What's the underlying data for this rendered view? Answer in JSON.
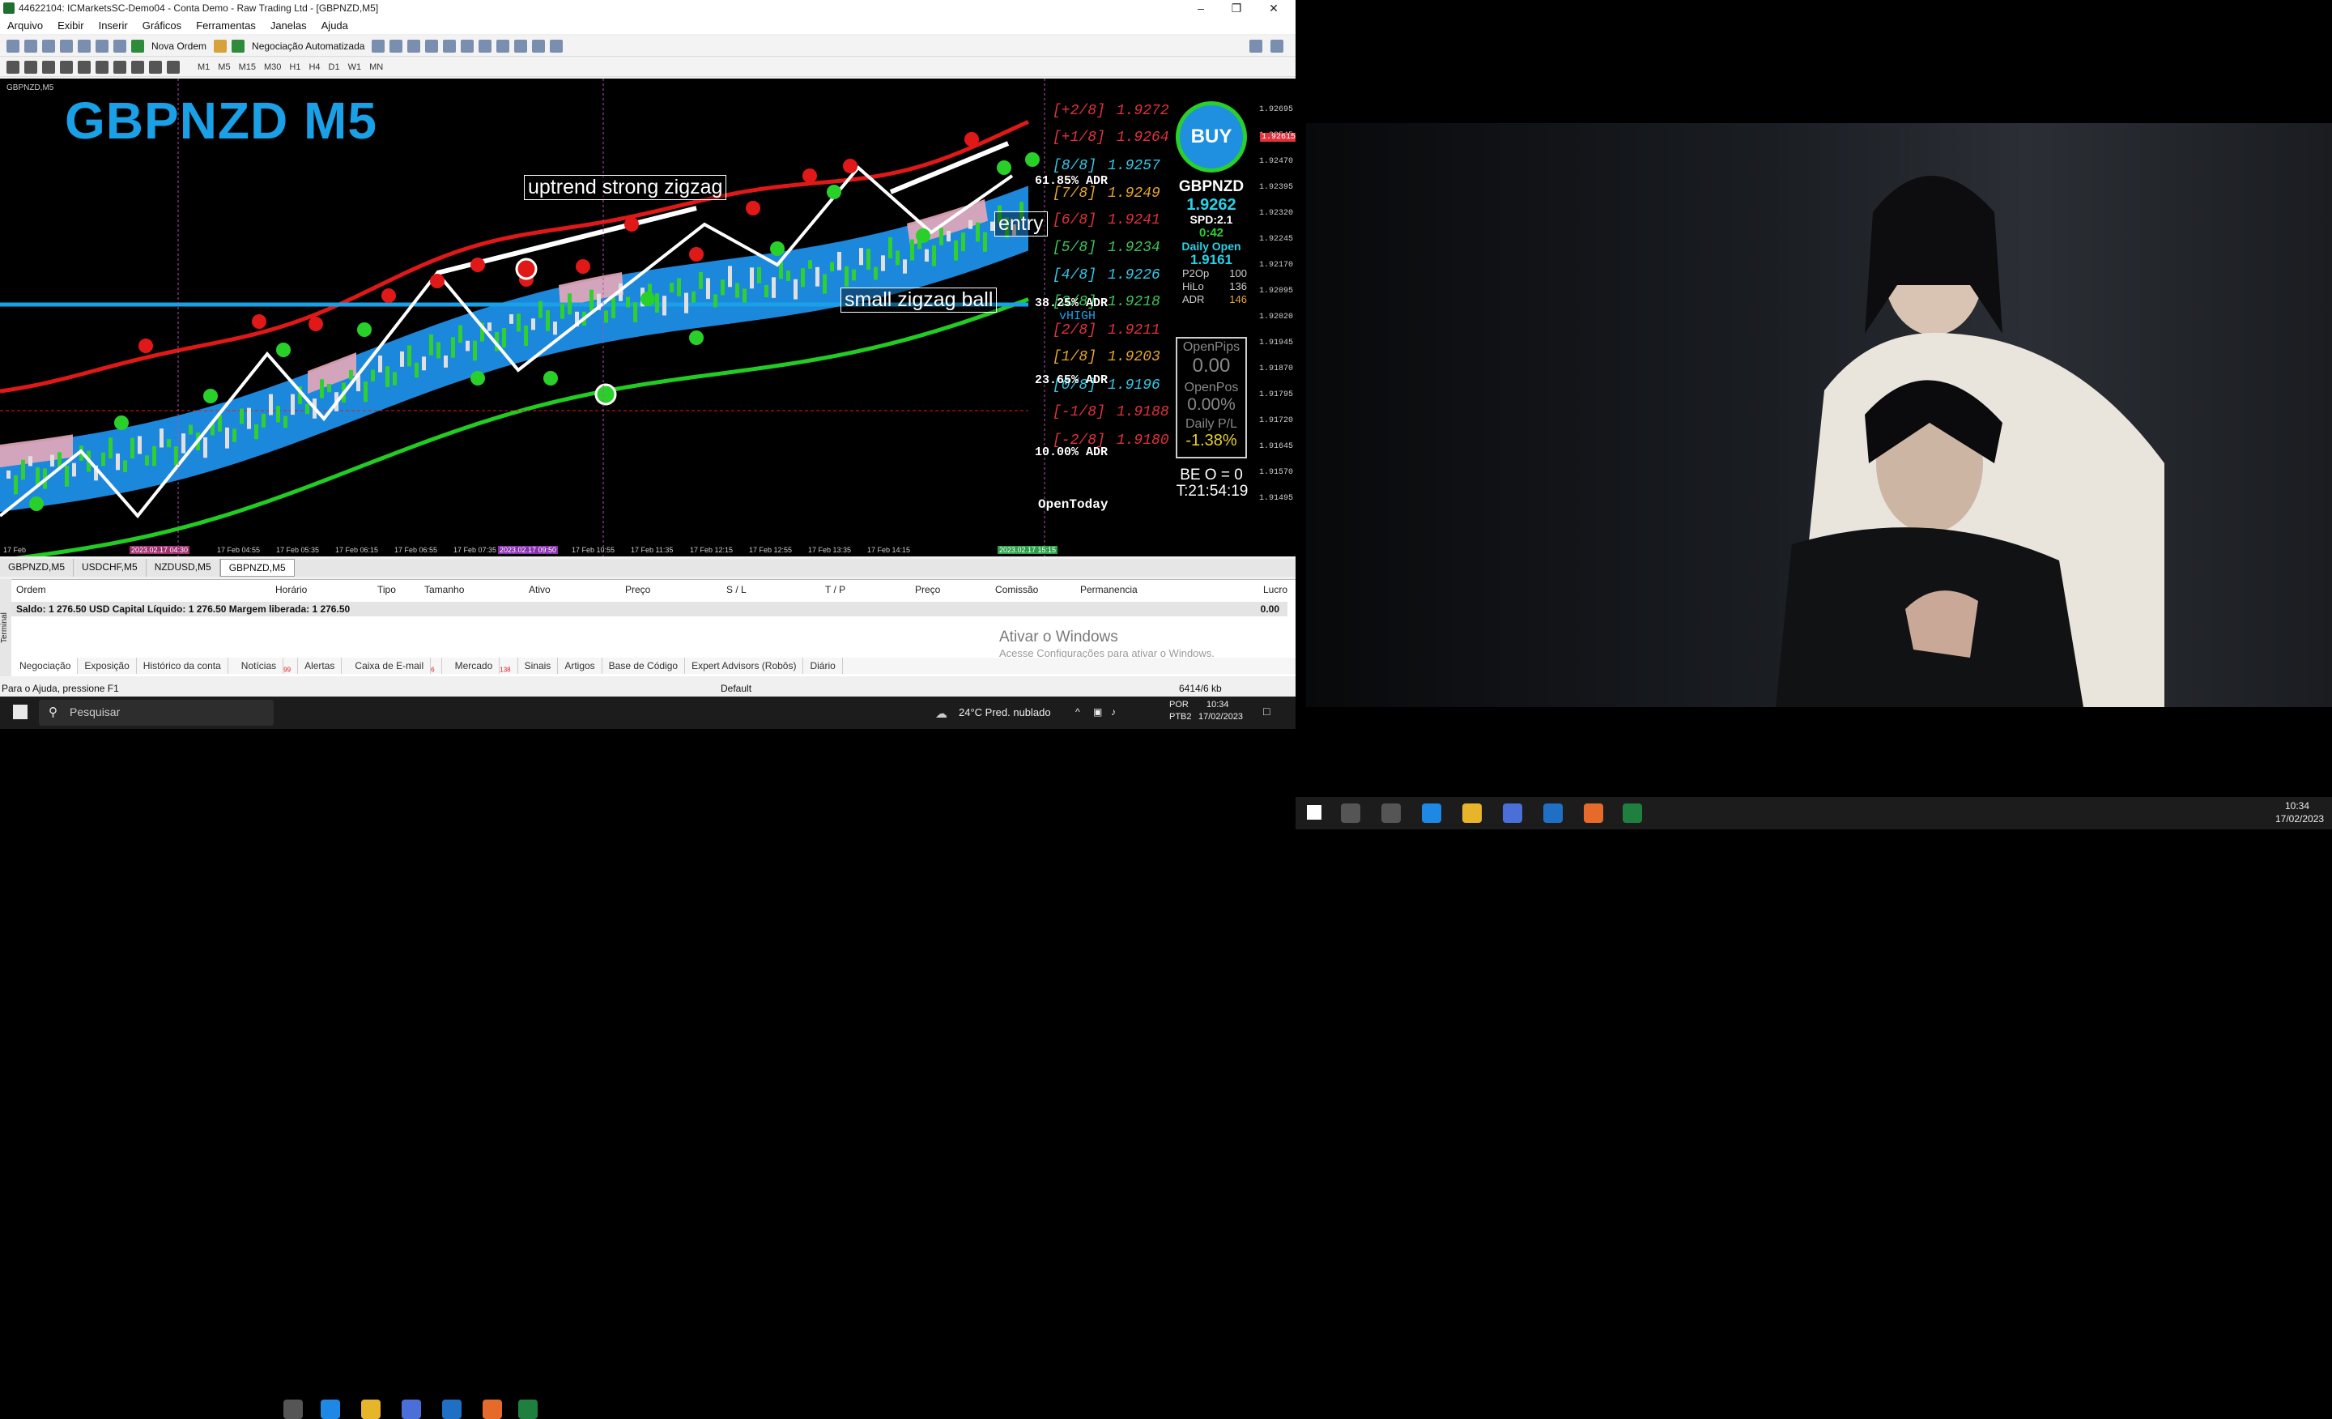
{
  "window": {
    "title": "44622104: ICMarketsSC-Demo04 - Conta Demo - Raw Trading Ltd - [GBPNZD,M5]"
  },
  "menu": [
    "Arquivo",
    "Exibir",
    "Inserir",
    "Gráficos",
    "Ferramentas",
    "Janelas",
    "Ajuda"
  ],
  "toolbar": {
    "new_order": "Nova Ordem",
    "auto_trading": "Negociação Automatizada"
  },
  "timeframes": [
    "M1",
    "M5",
    "M15",
    "M30",
    "H1",
    "H4",
    "D1",
    "W1",
    "MN"
  ],
  "chart": {
    "symbol_label": "GBPNZD M5",
    "chip_label": "GBPNZD,M5",
    "annotations": {
      "uptrend": "uptrend strong zigzag",
      "entry": "entry",
      "small": "small zigzag ball"
    },
    "levels": [
      {
        "label": "[+2/8]",
        "value": "1.9272",
        "color": "#e0323c"
      },
      {
        "label": "[+1/8]",
        "value": "1.9264",
        "color": "#e0323c"
      },
      {
        "label": "[8/8]",
        "value": "1.9257",
        "color": "#33c7e6"
      },
      {
        "label": "[7/8]",
        "value": "1.9249",
        "color": "#e6a62a"
      },
      {
        "label": "[6/8]",
        "value": "1.9241",
        "color": "#e0323c"
      },
      {
        "label": "[5/8]",
        "value": "1.9234",
        "color": "#3cc45a"
      },
      {
        "label": "[4/8]",
        "value": "1.9226",
        "color": "#33c7e6"
      },
      {
        "label": "[3/8]",
        "value": "1.9218",
        "color": "#3cc45a"
      },
      {
        "label": "[2/8]",
        "value": "1.9211",
        "color": "#e0323c"
      },
      {
        "label": "[1/8]",
        "value": "1.9203",
        "color": "#e6a62a"
      },
      {
        "label": "[0/8]",
        "value": "1.9196",
        "color": "#33c7e6"
      },
      {
        "label": "[-1/8]",
        "value": "1.9188",
        "color": "#e0323c"
      },
      {
        "label": "[-2/8]",
        "value": "1.9180",
        "color": "#e0323c"
      }
    ],
    "adr": {
      "a61": "61.85% ADR",
      "a38": "38.25% ADR",
      "a23": "23.65% ADR",
      "a10": "10.00% ADR",
      "vhigh": "vHIGH"
    },
    "open_today": "OpenToday",
    "price_axis": [
      "1.92695",
      "1.92545",
      "1.92470",
      "1.92395",
      "1.92320",
      "1.92245",
      "1.92170",
      "1.92095",
      "1.92020",
      "1.91945",
      "1.91870",
      "1.91795",
      "1.91720",
      "1.91645",
      "1.91570",
      "1.91495"
    ],
    "current_price": "1.92615",
    "time_axis": [
      "17 Feb 04:55",
      "17 Feb 05:35",
      "17 Feb 06:15",
      "17 Feb 06:55",
      "17 Feb 07:35",
      "17 Feb 10:15",
      "17 Feb 10:55",
      "17 Feb 11:35",
      "17 Feb 12:15",
      "17 Feb 12:55",
      "17 Feb 13:35",
      "17 Feb 14:15"
    ],
    "time_axis_first": "17 Feb",
    "time_axis_tag1": "2023.02.17 04:30",
    "time_axis_tag2": "2023.02.17 09:50",
    "time_axis_last": "2023.02.17 15:15"
  },
  "panel": {
    "buy": "BUY",
    "symbol": "GBPNZD",
    "price": "1.9262",
    "spread": "SPD:2.1",
    "timer": "0:42",
    "daily_open_label": "Daily Open",
    "daily_open": "1.9161",
    "p20p_label": "P2Op",
    "p20p": "100",
    "hilo_label": "HiLo",
    "hilo": "136",
    "adr_label": "ADR",
    "adr": "146",
    "open_pips_label": "OpenPips",
    "open_pips": "0.00",
    "open_pos_label": "OpenPos",
    "open_pos": "0.00%",
    "daily_pl_label": "Daily P/L",
    "daily_pl": "-1.38%",
    "be": "BE O = 0",
    "t": "T:21:54:19"
  },
  "chart_tabs": [
    "GBPNZD,M5",
    "USDCHF,M5",
    "NZDUSD,M5",
    "GBPNZD,M5"
  ],
  "terminal": {
    "headers": [
      "Ordem",
      "Horário",
      "Tipo",
      "Tamanho",
      "Ativo",
      "Preço",
      "S / L",
      "T / P",
      "Preço",
      "Comissão",
      "Permanencia",
      "Lucro"
    ],
    "balance_text": "Saldo: 1 276.50 USD  Capital Líquido: 1 276.50  Margem liberada: 1 276.50",
    "balance_value": "0.00",
    "side_label": "Terminal",
    "watermark": "Ativar o Windows",
    "watermark_sub": "Acesse Configurações para ativar o Windows.",
    "tabs": [
      "Negociação",
      "Exposição",
      "Histórico da conta",
      "Notícias",
      "Alertas",
      "Caixa de E-mail",
      "Mercado",
      "Sinais",
      "Artigos",
      "Base de Código",
      "Expert Advisors (Robôs)",
      "Diário"
    ],
    "news_badge": "99",
    "mail_badge": "6",
    "market_badge": "138"
  },
  "status": {
    "help": "Para o Ajuda, pressione F1",
    "profile": "Default",
    "traffic": "6414/6 kb"
  },
  "taskbar": {
    "search": "Pesquisar",
    "weather": "24°C  Pred. nublado",
    "lang": "POR",
    "layout": "PTB2",
    "time": "10:34",
    "date": "17/02/2023"
  },
  "right_taskbar": {
    "time": "10:34",
    "date": "17/02/2023"
  }
}
